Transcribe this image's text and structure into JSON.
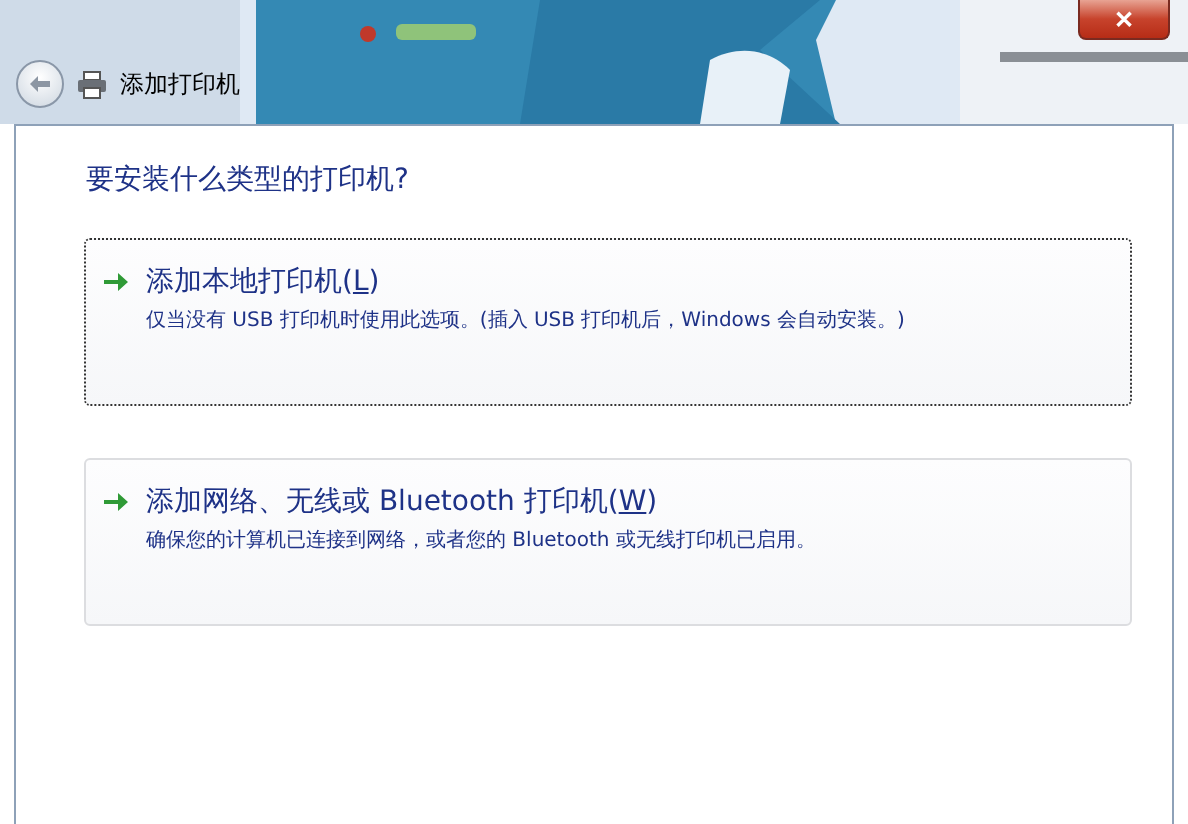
{
  "window": {
    "title": "添加打印机",
    "close_label": "✕"
  },
  "heading": "要安装什么类型的打印机?",
  "options": [
    {
      "title_before": "添加本地打印机(",
      "access_key": "L",
      "title_after": ")",
      "description": "仅当没有 USB 打印机时使用此选项。(插入 USB 打印机后，Windows 会自动安装。)",
      "focused": true
    },
    {
      "title_before": "添加网络、无线或 Bluetooth 打印机(",
      "access_key": "W",
      "title_after": ")",
      "description": "确保您的计算机已连接到网络，或者您的 Bluetooth 或无线打印机已启用。",
      "focused": false
    }
  ]
}
